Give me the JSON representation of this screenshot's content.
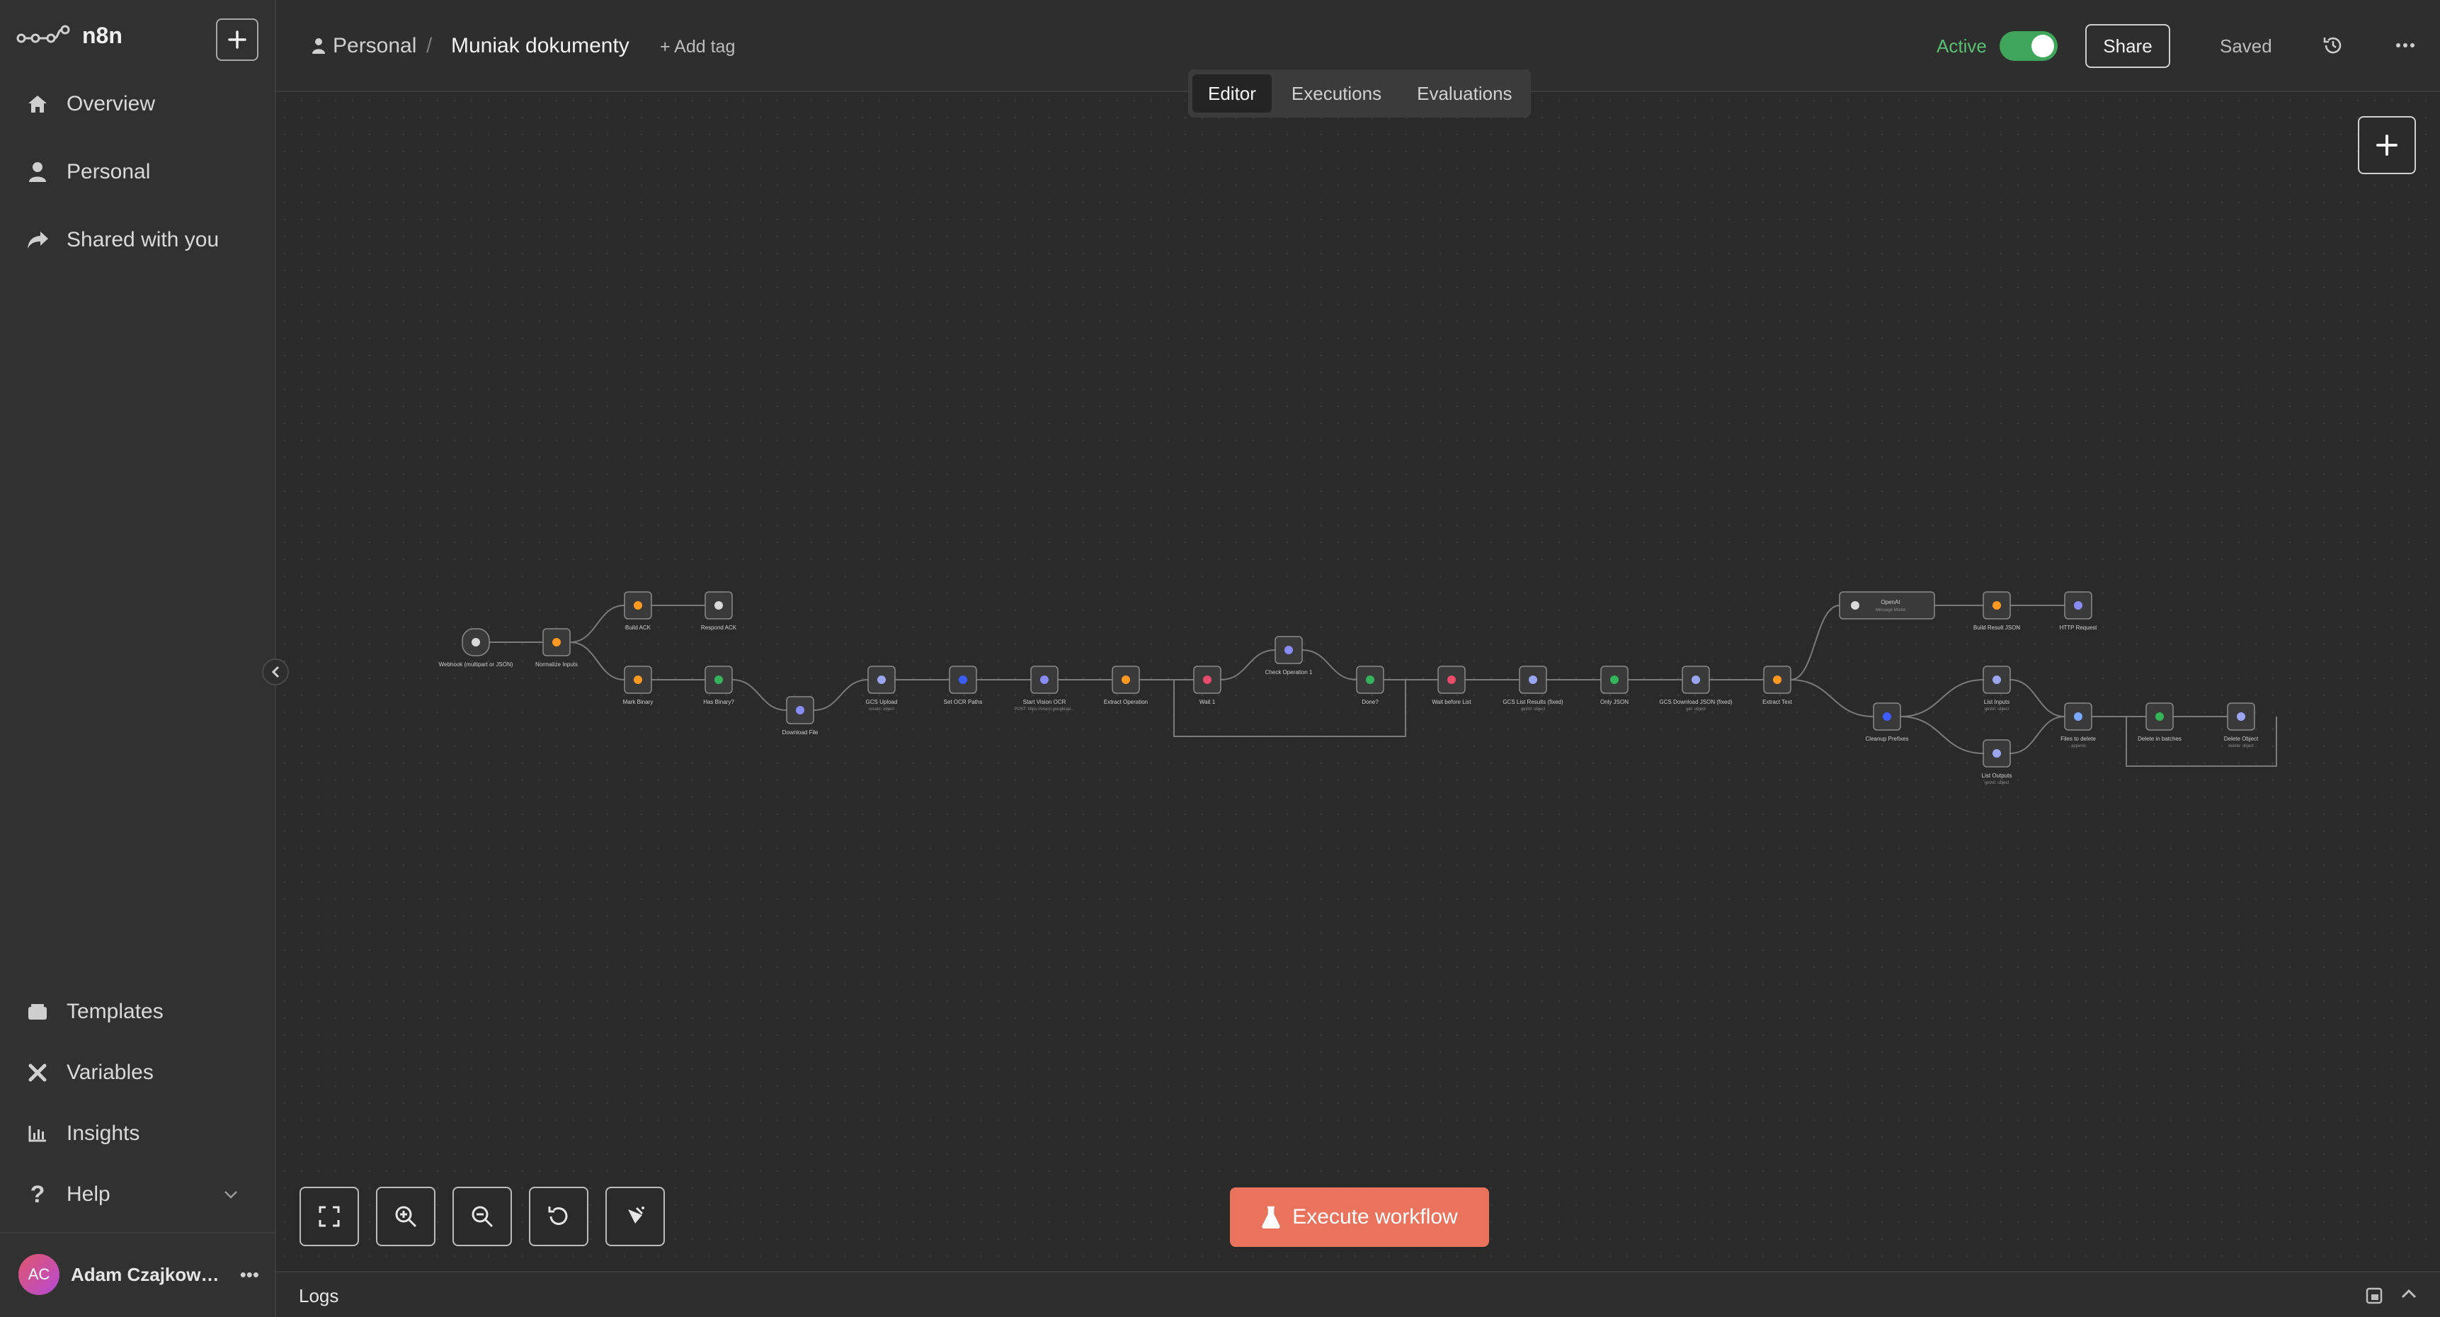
{
  "app": {
    "name": "n8n"
  },
  "sidebar": {
    "new_button": "+",
    "items": [
      {
        "label": "Overview",
        "icon": "home-icon"
      },
      {
        "label": "Personal",
        "icon": "user-icon"
      },
      {
        "label": "Shared with you",
        "icon": "share-icon"
      }
    ],
    "bottom_items": [
      {
        "label": "Templates",
        "icon": "templates-icon"
      },
      {
        "label": "Variables",
        "icon": "variables-icon"
      },
      {
        "label": "Insights",
        "icon": "insights-icon"
      },
      {
        "label": "Help",
        "icon": "help-icon"
      }
    ],
    "user": {
      "initials": "AC",
      "name": "Adam Czajkow…",
      "menu": "•••"
    }
  },
  "header": {
    "project": "Personal",
    "separator": "/",
    "workflow_name": "Muniak dokumenty",
    "add_tag": "+ Add tag",
    "active_label": "Active",
    "active": true,
    "share": "Share",
    "saved": "Saved"
  },
  "tabs": [
    {
      "label": "Editor",
      "active": true
    },
    {
      "label": "Executions",
      "active": false
    },
    {
      "label": "Evaluations",
      "active": false
    }
  ],
  "workflow_nodes": [
    {
      "label": "Webhook (multipart or JSON)",
      "icon": "webhook-icon"
    },
    {
      "label": "Normalize Inputs",
      "icon": "code-icon"
    },
    {
      "label": "Build ACK",
      "icon": "code-icon"
    },
    {
      "label": "Respond ACK",
      "icon": "webhook-icon"
    },
    {
      "label": "Mark Binary",
      "icon": "code-icon"
    },
    {
      "label": "Has Binary?",
      "icon": "if-icon"
    },
    {
      "label": "Download File",
      "icon": "globe-icon"
    },
    {
      "label": "GCS Upload",
      "sub": "create: object",
      "icon": "gcs-icon"
    },
    {
      "label": "Set OCR Paths",
      "icon": "set-icon"
    },
    {
      "label": "Start Vision OCR",
      "sub": "POST: https://vision.googleapi...",
      "icon": "globe-icon"
    },
    {
      "label": "Extract Operation",
      "icon": "code-icon"
    },
    {
      "label": "Wait 1",
      "icon": "wait-icon"
    },
    {
      "label": "Check Operation 1",
      "icon": "globe-icon"
    },
    {
      "label": "Done?",
      "icon": "if-icon"
    },
    {
      "label": "Wait before List",
      "icon": "wait-icon"
    },
    {
      "label": "GCS List Results (fixed)",
      "sub": "getAll: object",
      "icon": "gcs-icon"
    },
    {
      "label": "Only JSON",
      "icon": "if-icon"
    },
    {
      "label": "GCS Download JSON (fixed)",
      "sub": "get: object",
      "icon": "gcs-icon"
    },
    {
      "label": "Extract Text",
      "icon": "code-icon"
    },
    {
      "label": "OpenAI",
      "sub": "Message Model",
      "icon": "openai-icon"
    },
    {
      "label": "Build Result JSON",
      "icon": "code-icon"
    },
    {
      "label": "HTTP Request",
      "icon": "globe-icon"
    },
    {
      "label": "Cleanup Prefixes",
      "icon": "set-icon"
    },
    {
      "label": "List Inputs",
      "sub": "getAll: object",
      "icon": "gcs-icon"
    },
    {
      "label": "List Outputs",
      "sub": "getAll: object",
      "icon": "gcs-icon"
    },
    {
      "label": "Files to delete",
      "sub": "append",
      "icon": "merge-icon"
    },
    {
      "label": "Delete in batches",
      "icon": "batch-icon"
    },
    {
      "label": "Delete Object",
      "sub": "delete: object",
      "icon": "gcs-icon"
    }
  ],
  "controls": [
    "fit-view",
    "zoom-in",
    "zoom-out",
    "reset-zoom",
    "tidy-up"
  ],
  "execute_button": "Execute workflow",
  "logs": {
    "label": "Logs"
  },
  "colors": {
    "accent": "#e9735d",
    "active": "#3fa55a",
    "code": "#ff9922",
    "if": "#35b35b",
    "globe": "#8a8cf5",
    "wait": "#e74c6b"
  }
}
